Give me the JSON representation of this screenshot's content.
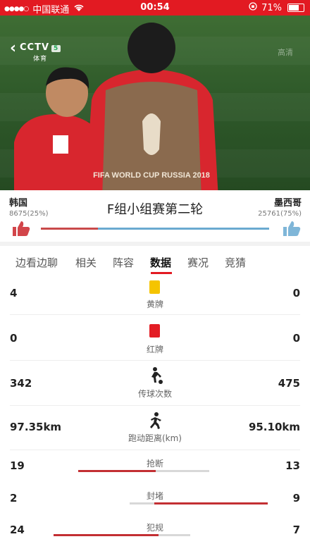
{
  "status_bar": {
    "carrier": "中国联通",
    "time": "00:54",
    "battery": "71%",
    "battery_level": 0.71
  },
  "video": {
    "channel_logo": "CCTV",
    "channel_number": "5",
    "channel_sub": "体育",
    "watermark": "高清",
    "shirt_text": "FIFA WORLD CUP RUSSIA 2018"
  },
  "match": {
    "title": "F组小组赛第二轮",
    "home": {
      "name": "韩国",
      "votes": "8675(25%)"
    },
    "away": {
      "name": "墨西哥",
      "votes": "25761(75%)"
    },
    "home_vote_share": 0.25,
    "away_vote_share": 0.75,
    "colors": {
      "home": "#c9494a",
      "away": "#6aaad0"
    }
  },
  "tabs": [
    {
      "label": "边看边聊",
      "active": false
    },
    {
      "label": "相关",
      "active": false
    },
    {
      "label": "阵容",
      "active": false
    },
    {
      "label": "数据",
      "active": true
    },
    {
      "label": "赛况",
      "active": false
    },
    {
      "label": "竞猜",
      "active": false
    }
  ],
  "stats": [
    {
      "label": "黄牌",
      "home": "4",
      "away": "0",
      "icon": "yellow-card-icon"
    },
    {
      "label": "红牌",
      "home": "0",
      "away": "0",
      "icon": "red-card-icon"
    },
    {
      "label": "传球次数",
      "home": "342",
      "away": "475",
      "icon": "pass-icon"
    },
    {
      "label": "跑动距离(km)",
      "home": "97.35km",
      "away": "95.10km",
      "icon": "running-icon"
    },
    {
      "label": "抢断",
      "home": "19",
      "away": "13",
      "home_share": 0.59
    },
    {
      "label": "封堵",
      "home": "2",
      "away": "9",
      "home_share": 0.18
    },
    {
      "label": "犯规",
      "home": "24",
      "away": "7",
      "home_share": 0.77
    }
  ]
}
